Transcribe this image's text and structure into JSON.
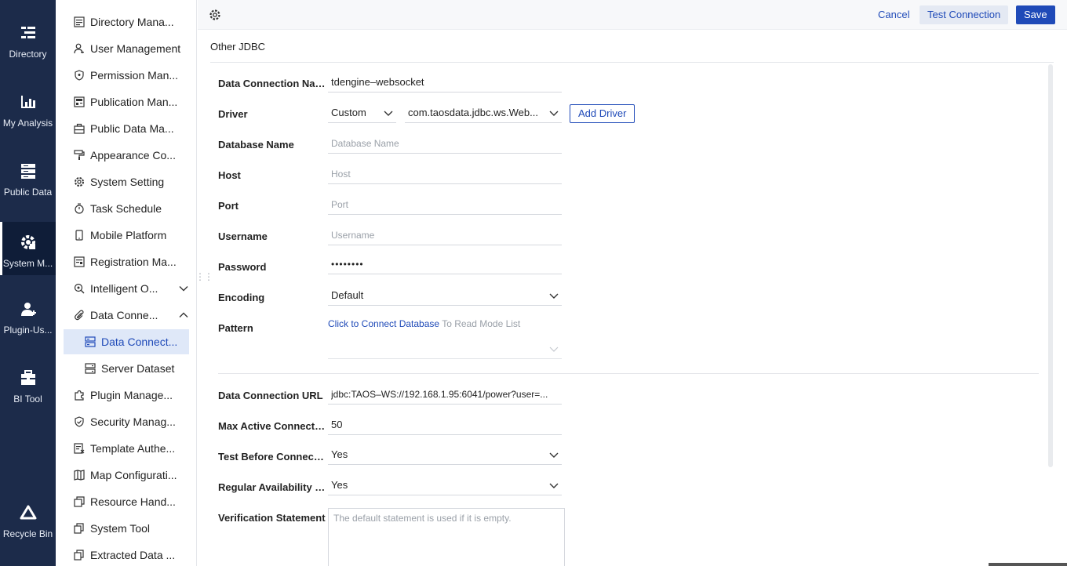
{
  "rail": [
    {
      "label": "Directory",
      "icon": "directory-icon"
    },
    {
      "label": "My Analysis",
      "icon": "analysis-chart-icon"
    },
    {
      "label": "Public Data",
      "icon": "database-icon"
    },
    {
      "label": "System M...",
      "icon": "system-gear-icon",
      "active": true
    },
    {
      "label": "Plugin-Us...",
      "icon": "plugin-user-icon"
    },
    {
      "label": "BI Tool",
      "icon": "toolbox-icon"
    },
    {
      "label": "Recycle Bin",
      "icon": "recycle-bin-icon"
    }
  ],
  "subnav": [
    {
      "label": "Directory Mana...",
      "icon": "list-icon"
    },
    {
      "label": "User Management",
      "icon": "user-icon"
    },
    {
      "label": "Permission Man...",
      "icon": "shield-icon"
    },
    {
      "label": "Publication Man...",
      "icon": "publication-icon"
    },
    {
      "label": "Public Data Ma...",
      "icon": "briefcase-icon"
    },
    {
      "label": "Appearance Co...",
      "icon": "paint-roller-icon"
    },
    {
      "label": "System Setting",
      "icon": "settings-icon"
    },
    {
      "label": "Task Schedule",
      "icon": "timer-icon"
    },
    {
      "label": "Mobile Platform",
      "icon": "mobile-icon"
    },
    {
      "label": "Registration Ma...",
      "icon": "registration-icon"
    },
    {
      "label": "Intelligent O...",
      "icon": "intelligent-icon",
      "chevron": "down"
    },
    {
      "label": "Data Conne...",
      "icon": "paperclip-icon",
      "chevron": "up"
    },
    {
      "label": "Data Connect...",
      "icon": "data-connection-icon",
      "sub": true,
      "selected": true
    },
    {
      "label": "Server Dataset",
      "icon": "server-dataset-icon",
      "sub": true
    },
    {
      "label": "Plugin Manage...",
      "icon": "puzzle-icon"
    },
    {
      "label": "Security Manag...",
      "icon": "security-icon"
    },
    {
      "label": "Template Authe...",
      "icon": "template-icon"
    },
    {
      "label": "Map Configurati...",
      "icon": "map-icon"
    },
    {
      "label": "Resource Hand...",
      "icon": "resource-icon"
    },
    {
      "label": "System Tool",
      "icon": "copy-icon"
    },
    {
      "label": "Extracted Data ...",
      "icon": "extract-icon"
    }
  ],
  "toolbar": {
    "cancel": "Cancel",
    "test": "Test Connection",
    "save": "Save"
  },
  "section_title": "Other JDBC",
  "form": {
    "connection_name": {
      "label": "Data Connection Name",
      "value": "tdengine–websocket"
    },
    "driver": {
      "label": "Driver",
      "type_value": "Custom",
      "class_value": "com.taosdata.jdbc.ws.Web...",
      "add_button": "Add Driver"
    },
    "database_name": {
      "label": "Database Name",
      "placeholder": "Database Name"
    },
    "host": {
      "label": "Host",
      "placeholder": "Host"
    },
    "port": {
      "label": "Port",
      "placeholder": "Port"
    },
    "username": {
      "label": "Username",
      "placeholder": "Username"
    },
    "password": {
      "label": "Password",
      "value": "••••••••"
    },
    "encoding": {
      "label": "Encoding",
      "value": "Default"
    },
    "pattern": {
      "label": "Pattern",
      "link": "Click to Connect Database",
      "suffix": " To Read Mode List"
    },
    "url": {
      "label": "Data Connection URL",
      "value": "jdbc:TAOS–WS://192.168.1.95:6041/power?user=..."
    },
    "max_active": {
      "label": "Max Active Connection",
      "value": "50"
    },
    "test_before": {
      "label": "Test Before Connection",
      "value": "Yes"
    },
    "regular_check": {
      "label": "Regular Availability C...",
      "value": "Yes"
    },
    "verification": {
      "label": "Verification Statement",
      "placeholder": "The default statement is used if it is empty."
    }
  }
}
